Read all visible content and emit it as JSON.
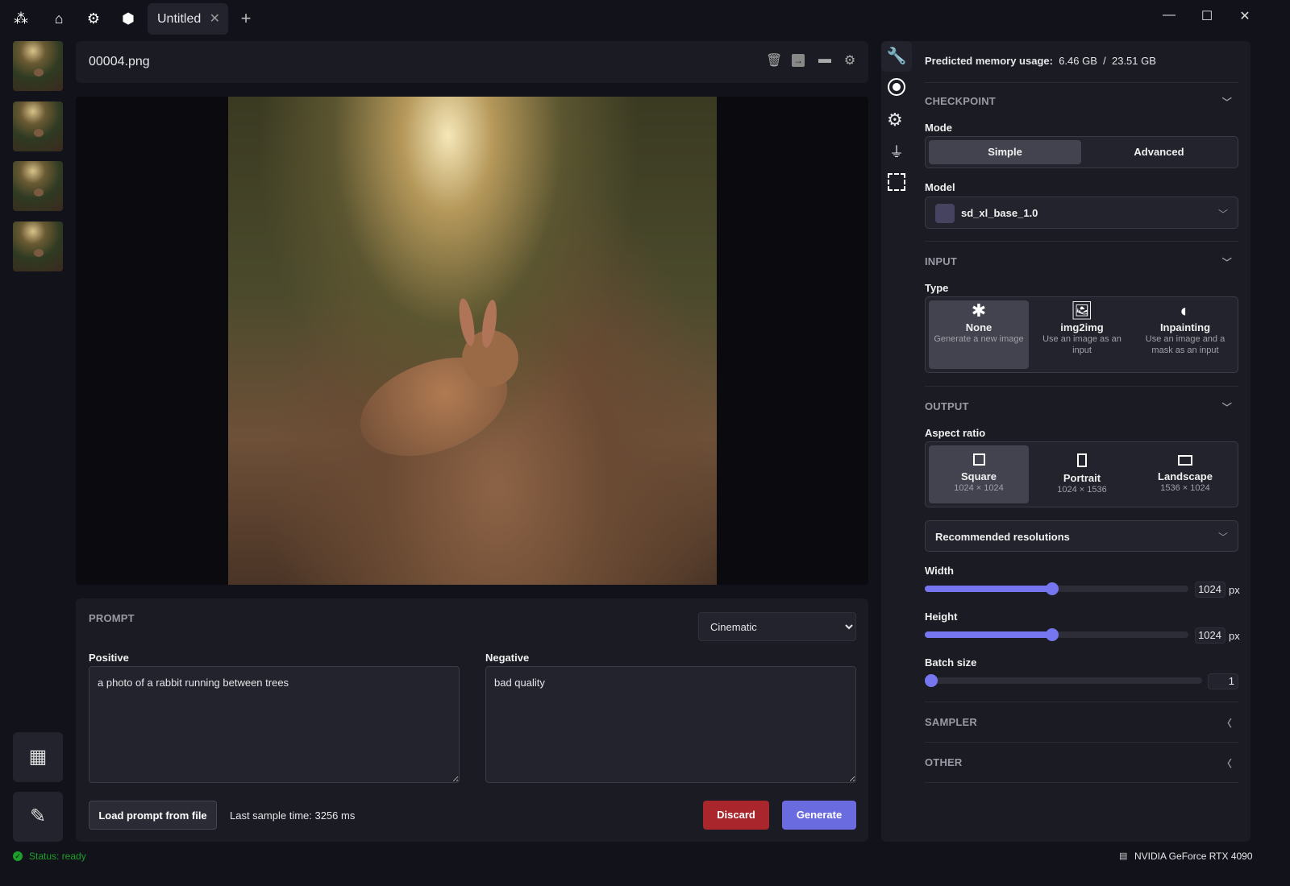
{
  "topbar": {
    "tab_title": "Untitled",
    "icons": [
      "logo-icon",
      "home-icon",
      "gear-icon",
      "cube-icon",
      "close-icon",
      "plus-icon",
      "minimize-icon",
      "maximize-icon",
      "close-window-icon"
    ]
  },
  "gallery": {
    "thumbnails": 4
  },
  "viewer": {
    "filename": "00004.png",
    "actions": [
      "trash-icon",
      "export-icon",
      "folder-icon",
      "gear-icon"
    ]
  },
  "prompt": {
    "section": "PROMPT",
    "style": "Cinematic",
    "positive_label": "Positive",
    "positive": "a photo of a rabbit running between trees",
    "negative_label": "Negative",
    "negative": "bad quality",
    "load_button": "Load prompt from file",
    "last_sample": "Last sample time: 3256 ms",
    "discard": "Discard",
    "generate": "Generate"
  },
  "settings": {
    "memory_label": "Predicted memory usage:",
    "memory_used": "6.46 GB",
    "memory_sep": "/",
    "memory_total": "23.51 GB",
    "checkpoint": {
      "title": "CHECKPOINT",
      "mode_label": "Mode",
      "modes": [
        "Simple",
        "Advanced"
      ],
      "selected_mode": "Simple",
      "model_label": "Model",
      "model": "sd_xl_base_1.0"
    },
    "input": {
      "title": "INPUT",
      "type_label": "Type",
      "types": [
        {
          "name": "None",
          "desc": "Generate a new image"
        },
        {
          "name": "img2img",
          "desc": "Use an image as an input"
        },
        {
          "name": "Inpainting",
          "desc": "Use an image and a mask as an input"
        }
      ],
      "selected": "None"
    },
    "output": {
      "title": "OUTPUT",
      "aspect_label": "Aspect ratio",
      "aspects": [
        {
          "name": "Square",
          "size": "1024 × 1024"
        },
        {
          "name": "Portrait",
          "size": "1024 × 1536"
        },
        {
          "name": "Landscape",
          "size": "1536 × 1024"
        }
      ],
      "selected": "Square",
      "recommended": "Recommended resolutions",
      "width_label": "Width",
      "width": "1024",
      "width_fraction": 0.484,
      "height_label": "Height",
      "height": "1024",
      "height_fraction": 0.484,
      "unit": "px",
      "batch_label": "Batch size",
      "batch": "1",
      "batch_fraction": 0
    },
    "sampler": {
      "title": "SAMPLER"
    },
    "other": {
      "title": "OTHER"
    }
  },
  "status": {
    "text": "Status: ready",
    "gpu": "NVIDIA GeForce RTX 4090"
  },
  "colors": {
    "accent": "#6b6be0",
    "discard": "#a8262c",
    "status": "#1f9d2a"
  }
}
